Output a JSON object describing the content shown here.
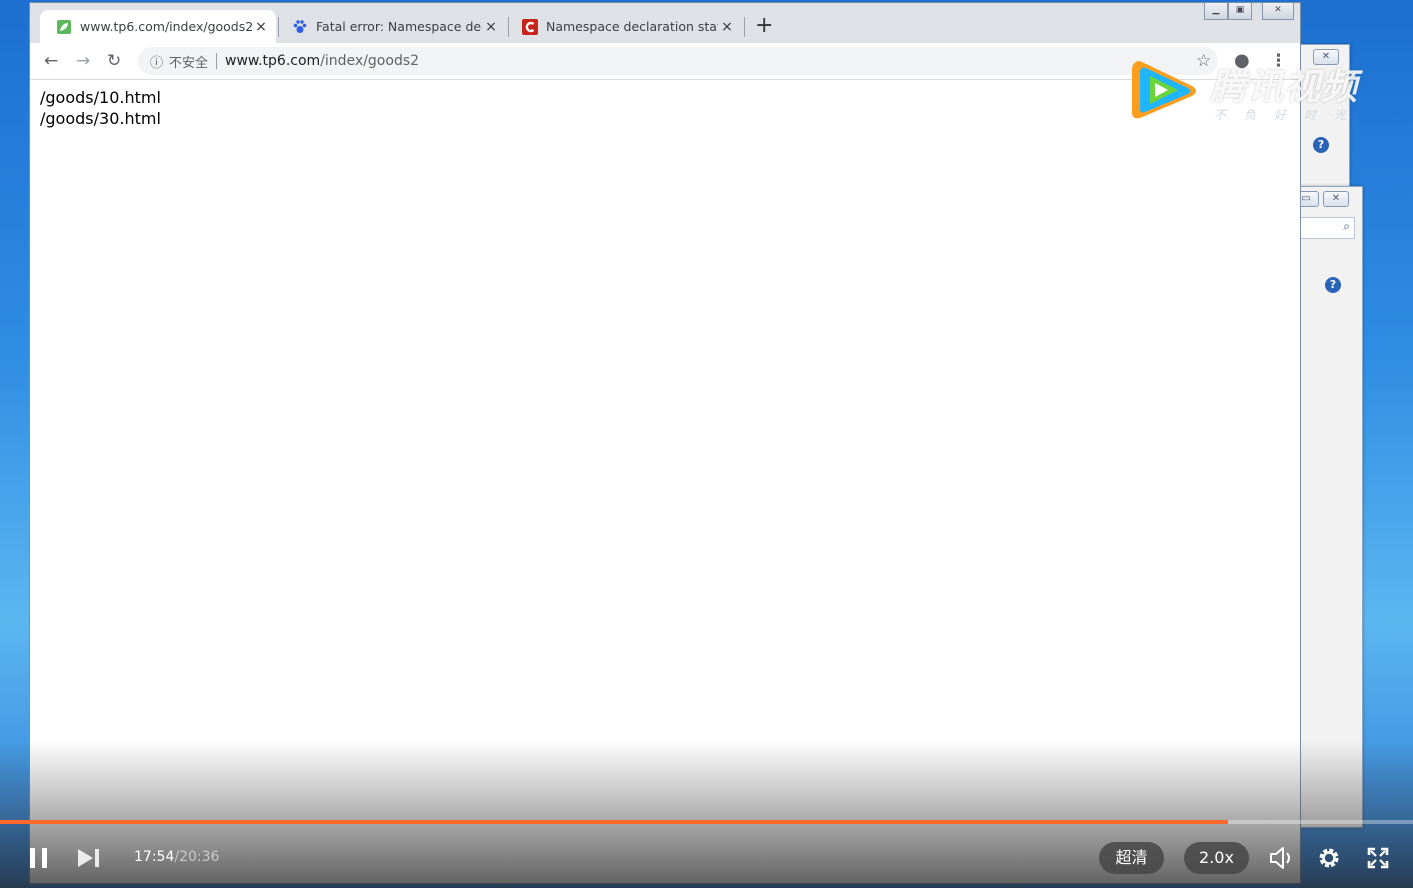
{
  "browser": {
    "tabs": [
      {
        "title": "www.tp6.com/index/goods2",
        "active": true,
        "icon": "leaf-icon"
      },
      {
        "title": "Fatal error: Namespace declara",
        "active": false,
        "icon": "paw-icon"
      },
      {
        "title": "Namespace declaration statem",
        "active": false,
        "icon": "c-logo-icon"
      }
    ],
    "new_tab_label": "+",
    "close_label": "×",
    "security_label": "不安全",
    "url_host": "www.tp6.com",
    "url_path": "/index/goods2"
  },
  "page": {
    "lines": [
      "/goods/10.html",
      "/goods/30.html"
    ]
  },
  "watermark": {
    "brand": "腾讯视频",
    "slogan": "不负好时光"
  },
  "player": {
    "current_time": "17:54",
    "duration": "/20:36",
    "progress_fraction": 0.869,
    "quality_label": "超清",
    "speed_label": "2.0x",
    "accent_color": "#ff6a2b"
  }
}
